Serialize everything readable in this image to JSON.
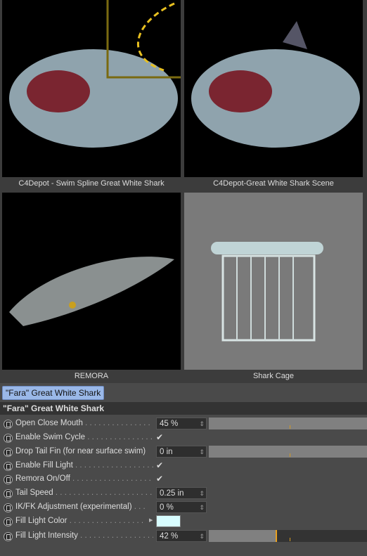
{
  "thumbnails": [
    {
      "caption": "C4Depot - Swim Spline Great White Shark"
    },
    {
      "caption": "C4Depot-Great White Shark Scene"
    },
    {
      "caption": "REMORA"
    },
    {
      "caption": "Shark Cage"
    }
  ],
  "tab": {
    "label": "\"Fara\" Great White Shark"
  },
  "section": {
    "title": "\"Fara\" Great White Shark"
  },
  "params": [
    {
      "label": "Open Close Mouth",
      "value": "45 %",
      "slider": 1.0
    },
    {
      "label": "Enable Swim Cycle",
      "checked": true
    },
    {
      "label": "Drop Tail Fin (for near surface swim)",
      "value": "0 in",
      "slider": 1.0
    },
    {
      "label": "Enable Fill Light",
      "checked": true
    },
    {
      "label": "Remora On/Off",
      "checked": true
    },
    {
      "label": "Tail Speed",
      "value": "0.25 in"
    },
    {
      "label": "IK/FK Adjustment (experimental)",
      "value": "0 %"
    },
    {
      "label": "Fill Light Color",
      "color": "#d8fdff"
    },
    {
      "label": "Fill Light Intensity",
      "value": "42 %",
      "slider": 0.42
    }
  ]
}
